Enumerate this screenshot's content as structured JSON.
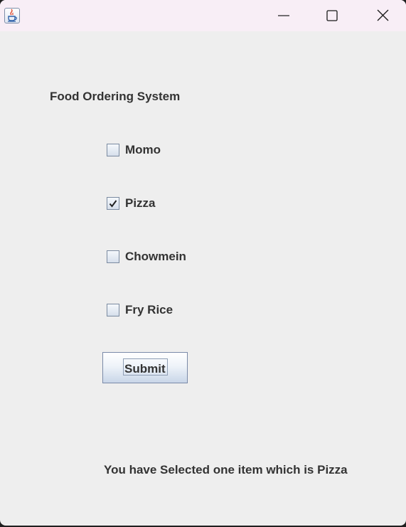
{
  "window": {
    "icon": "java-cup-icon",
    "controls": [
      "minimize-icon",
      "maximize-icon",
      "close-icon"
    ]
  },
  "main": {
    "heading": "Food Ordering System",
    "items": [
      {
        "label": "Momo",
        "checked": false
      },
      {
        "label": "Pizza",
        "checked": true
      },
      {
        "label": "Chowmein",
        "checked": false
      },
      {
        "label": "Fry Rice",
        "checked": false
      }
    ],
    "submit_label": "Submit",
    "result_text": "You have Selected one item which is Pizza"
  }
}
